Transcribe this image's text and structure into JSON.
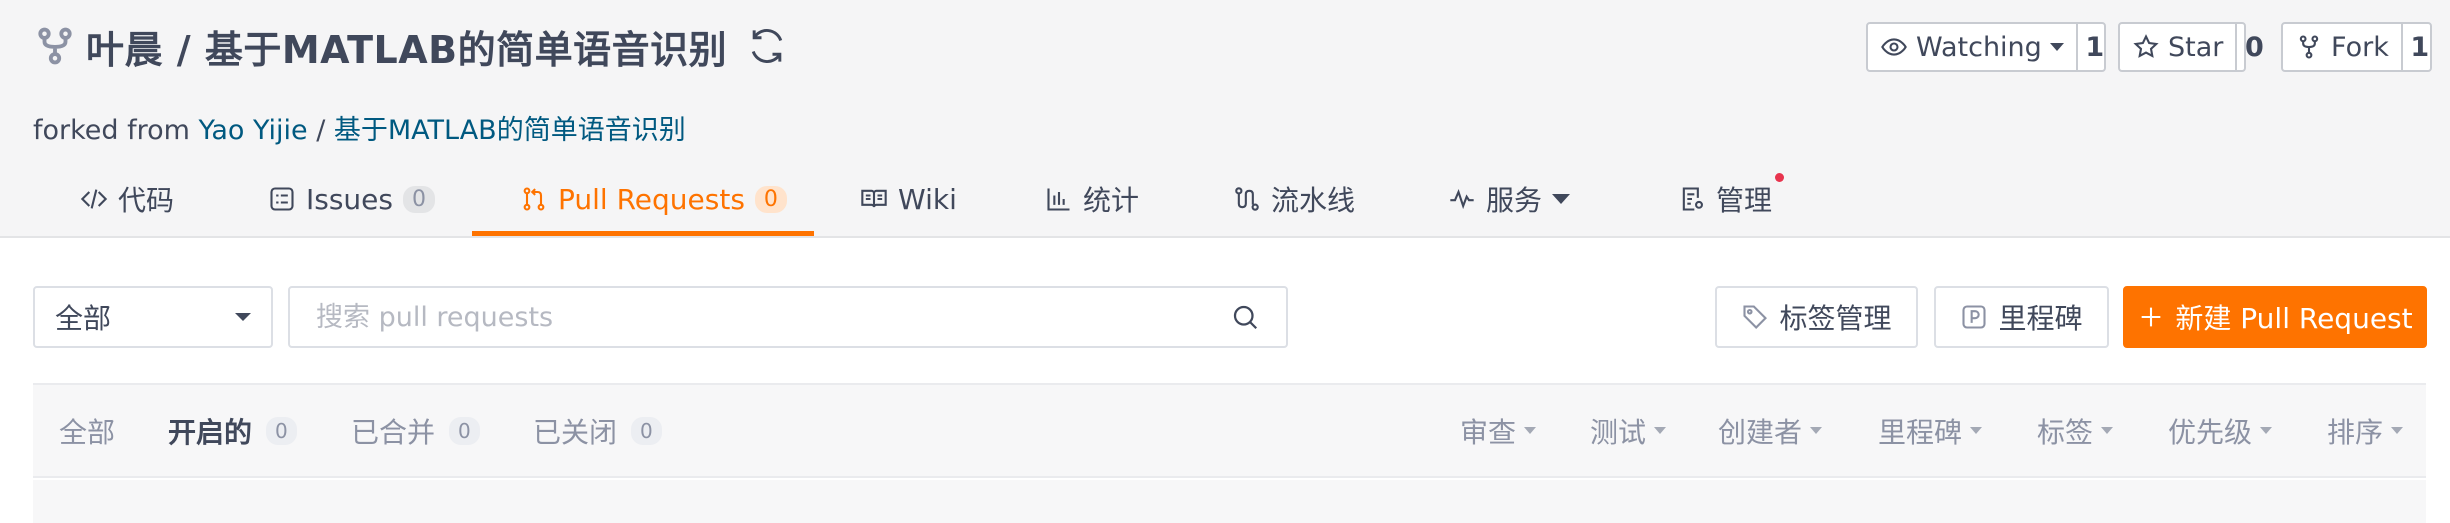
{
  "repo": {
    "owner": "叶晨",
    "separator": " / ",
    "name": "基于MATLAB的简单语音识别",
    "forked_prefix": "forked from ",
    "forked_owner": "Yao Yijie",
    "forked_sep": " / ",
    "forked_name": "基于MATLAB的简单语音识别"
  },
  "actions": {
    "watch_label": "Watching",
    "watch_count": "1",
    "star_label": "Star",
    "star_count": "0",
    "fork_label": "Fork",
    "fork_count": "1"
  },
  "tabs": [
    {
      "label": "代码",
      "icon": "code-icon"
    },
    {
      "label": "Issues",
      "badge": "0",
      "icon": "issues-icon"
    },
    {
      "label": "Pull Requests",
      "badge": "0",
      "icon": "pull-request-icon",
      "active": true
    },
    {
      "label": "Wiki",
      "icon": "book-icon"
    },
    {
      "label": "统计",
      "icon": "bar-chart-icon"
    },
    {
      "label": "流水线",
      "icon": "pipeline-icon"
    },
    {
      "label": "服务",
      "icon": "pulse-icon"
    },
    {
      "label": "管理",
      "icon": "settings-doc-icon"
    }
  ],
  "toolbar": {
    "select_value": "全部",
    "search_placeholder": "搜索 pull requests",
    "labels_button": "标签管理",
    "milestones_button": "里程碑",
    "new_pr_button": "新建 Pull Request"
  },
  "states": [
    {
      "label": "全部"
    },
    {
      "label": "开启的",
      "count": "0",
      "active": true
    },
    {
      "label": "已合并",
      "count": "0"
    },
    {
      "label": "已关闭",
      "count": "0"
    }
  ],
  "filters": [
    "审查",
    "测试",
    "创建者",
    "里程碑",
    "标签",
    "优先级",
    "排序"
  ],
  "colors": {
    "accent": "#fe7300",
    "link": "#005980",
    "text": "#40485b",
    "muted": "#8c92a4",
    "notify_dot": "#e8344e"
  }
}
